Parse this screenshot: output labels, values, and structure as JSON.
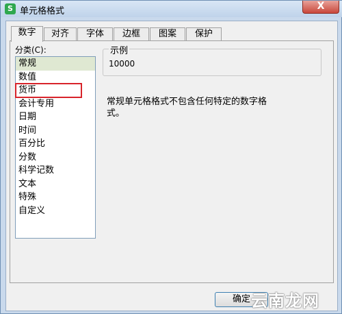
{
  "window": {
    "title": "单元格格式",
    "app_icon": "S",
    "close_glyph": "X"
  },
  "tabs": [
    "数字",
    "对齐",
    "字体",
    "边框",
    "图案",
    "保护"
  ],
  "active_tab": 0,
  "category": {
    "label": "分类(C):",
    "items": [
      "常规",
      "数值",
      "货币",
      "会计专用",
      "日期",
      "时间",
      "百分比",
      "分数",
      "科学记数",
      "文本",
      "特殊",
      "自定义"
    ],
    "selected_index": 0,
    "highlighted_index": 2
  },
  "sample": {
    "legend": "示例",
    "value": "10000"
  },
  "description": "常规单元格格式不包含任何特定的数字格式。",
  "buttons": {
    "ok": "确定"
  },
  "watermark": "云南龙网",
  "colors": {
    "highlight_box": "#d8232a",
    "selected_row": "#dfe8d2"
  }
}
